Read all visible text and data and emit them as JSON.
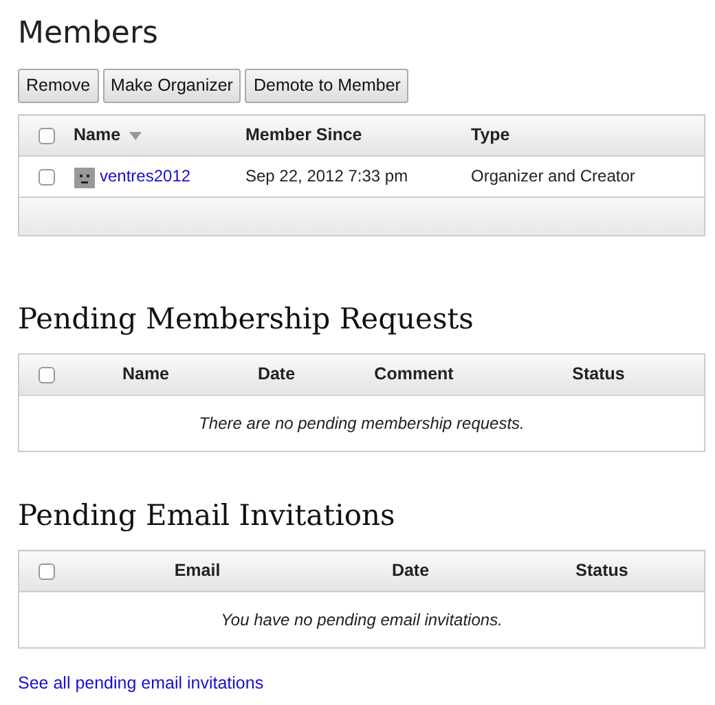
{
  "members": {
    "title": "Members",
    "buttons": [
      "Remove",
      "Make Organizer",
      "Demote to Member"
    ],
    "select_all": {
      "checked": false
    },
    "columns": [
      {
        "label": "Name",
        "sorted": true
      },
      {
        "label": "Member Since",
        "sorted": false
      },
      {
        "label": "Type",
        "sorted": false
      }
    ],
    "rows": [
      {
        "checked": false,
        "name": "ventres2012",
        "member_since": "Sep 22, 2012 7:33 pm",
        "type": "Organizer and Creator"
      }
    ]
  },
  "requests": {
    "title": "Pending Membership Requests",
    "select_all": {
      "checked": false
    },
    "columns": [
      "Name",
      "Date",
      "Comment",
      "Status"
    ],
    "empty_message": "There are no pending membership requests."
  },
  "invitations": {
    "title": "Pending Email Invitations",
    "select_all": {
      "checked": false
    },
    "columns": [
      "Email",
      "Date",
      "Status"
    ],
    "empty_message": "You have no pending email invitations."
  },
  "link": "See all pending email invitations"
}
